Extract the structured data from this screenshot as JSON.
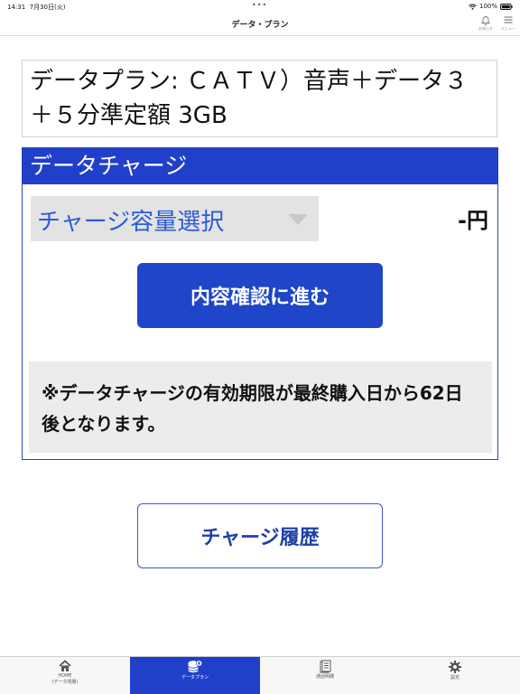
{
  "status_bar": {
    "time": "14:31",
    "date": "7月30日(火)",
    "dots": "•••",
    "battery": "100%"
  },
  "nav": {
    "title": "データ・プラン",
    "notify_label": "お知らせ",
    "menu_label": "メニュー"
  },
  "plan": {
    "text": "データプラン: ＣＡＴＶ）音声＋データ３＋５分準定額 3GB"
  },
  "charge": {
    "header": "データチャージ",
    "select_text": "チャージ容量選択",
    "price": "-円",
    "confirm_label": "内容確認に進む",
    "notice": "※データチャージの有効期限が最終購入日から62日後となります。"
  },
  "history_label": "チャージ履歴",
  "tabs": [
    {
      "label": "HOME",
      "sublabel": "(データ残量)"
    },
    {
      "label": "データプラン"
    },
    {
      "label": "通話明細"
    },
    {
      "label": "設定"
    }
  ],
  "colors": {
    "accent": "#2140c9",
    "select_text": "#2a5bd9",
    "notice_bg": "#ececec"
  }
}
